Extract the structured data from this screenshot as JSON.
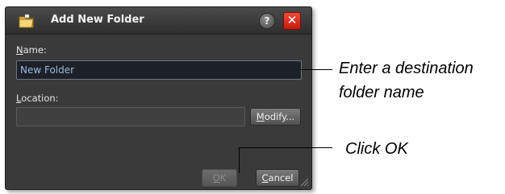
{
  "dialog": {
    "title": "Add New Folder",
    "help_label": "?",
    "close_label": "✕",
    "folder_icon": "folder-icon",
    "name_label_accel": "N",
    "name_label_rest": "ame:",
    "name_value": "New Folder",
    "location_label_accel": "L",
    "location_label_rest": "ocation:",
    "location_value": "",
    "modify_accel": "M",
    "modify_rest": "odify...",
    "ok_accel": "O",
    "ok_rest": "K",
    "ok_enabled": false,
    "cancel_accel": "C",
    "cancel_rest": "ancel"
  },
  "callouts": {
    "name_line1": "Enter a destination",
    "name_line2": "folder name",
    "ok": "Click OK"
  },
  "colors": {
    "dialog_bg": "#3a3a3a",
    "close_red": "#d9281c",
    "name_text": "#9fb6dc"
  }
}
